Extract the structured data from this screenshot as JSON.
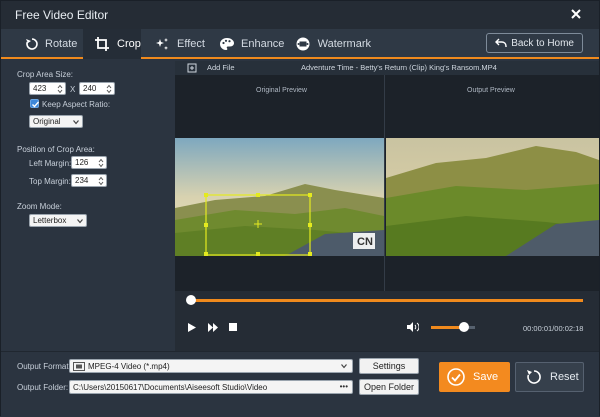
{
  "window": {
    "title": "Free Video Editor"
  },
  "tabs": [
    {
      "label": "Rotate",
      "icon": "rotate-icon"
    },
    {
      "label": "Crop",
      "icon": "crop-icon",
      "active": true
    },
    {
      "label": "Effect",
      "icon": "effect-icon"
    },
    {
      "label": "Enhance",
      "icon": "palette-icon"
    },
    {
      "label": "Watermark",
      "icon": "film-icon"
    }
  ],
  "back_home_label": "Back to Home",
  "crop": {
    "area_size_label": "Crop Area Size:",
    "width": "423",
    "x_label": "X",
    "height": "240",
    "keep_aspect_label": "Keep Aspect Ratio:",
    "keep_aspect_checked": true,
    "aspect_value": "Original",
    "position_label": "Position of Crop Area:",
    "left_margin_label": "Left Margin:",
    "left_margin": "126",
    "top_margin_label": "Top Margin:",
    "top_margin": "234",
    "zoom_mode_label": "Zoom Mode:",
    "zoom_mode": "Letterbox"
  },
  "file": {
    "add_label": "Add File",
    "name": "Adventure Time - Betty's Return (Clip) King's Ransom.MP4"
  },
  "preview": {
    "original_label": "Original Preview",
    "output_label": "Output Preview",
    "watermark": "CN"
  },
  "playback": {
    "time": "00:00:01/00:02:18",
    "progress": 0.01,
    "volume": 0.75
  },
  "output": {
    "format_label": "Output Format:",
    "format_value": "MPEG-4 Video (*.mp4)",
    "settings_label": "Settings",
    "folder_label": "Output Folder:",
    "folder_value": "C:\\Users\\20150617\\Documents\\Aiseesoft Studio\\Video",
    "more_label": "•••",
    "open_folder_label": "Open Folder",
    "save_label": "Save",
    "reset_label": "Reset"
  },
  "colors": {
    "accent": "#f38a1f",
    "bg": "#2b3440",
    "checkbox": "#3e87d8"
  }
}
